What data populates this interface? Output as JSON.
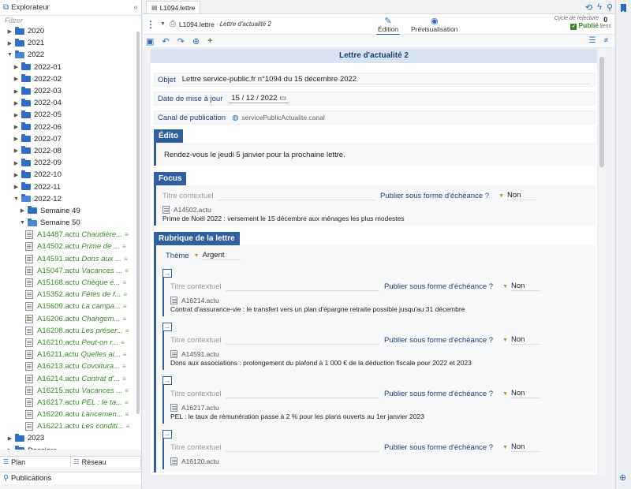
{
  "explorer": {
    "title": "Explorateur",
    "filter_placeholder": "Filtrer",
    "tree": [
      {
        "label": "2020",
        "kind": "folder",
        "level": 0,
        "expanded": false
      },
      {
        "label": "2021",
        "kind": "folder",
        "level": 0,
        "expanded": false
      },
      {
        "label": "2022",
        "kind": "folder",
        "level": 0,
        "expanded": true
      },
      {
        "label": "2022-01",
        "kind": "folder",
        "level": 1,
        "expanded": false
      },
      {
        "label": "2022-02",
        "kind": "folder",
        "level": 1,
        "expanded": false
      },
      {
        "label": "2022-03",
        "kind": "folder",
        "level": 1,
        "expanded": false
      },
      {
        "label": "2022-04",
        "kind": "folder",
        "level": 1,
        "expanded": false
      },
      {
        "label": "2022-05",
        "kind": "folder",
        "level": 1,
        "expanded": false
      },
      {
        "label": "2022-06",
        "kind": "folder",
        "level": 1,
        "expanded": false
      },
      {
        "label": "2022-07",
        "kind": "folder",
        "level": 1,
        "expanded": false
      },
      {
        "label": "2022-08",
        "kind": "folder",
        "level": 1,
        "expanded": false
      },
      {
        "label": "2022-09",
        "kind": "folder",
        "level": 1,
        "expanded": false
      },
      {
        "label": "2022-10",
        "kind": "folder",
        "level": 1,
        "expanded": false
      },
      {
        "label": "2022-11",
        "kind": "folder",
        "level": 1,
        "expanded": false
      },
      {
        "label": "2022-12",
        "kind": "folder",
        "level": 1,
        "expanded": true
      },
      {
        "label": "Semaine 49",
        "kind": "folder",
        "level": 2,
        "expanded": false
      },
      {
        "label": "Semaine 50",
        "kind": "folder",
        "level": 2,
        "expanded": true
      },
      {
        "id": "A14487.actu",
        "title": "Chaudière...",
        "kind": "doc",
        "level": 3
      },
      {
        "id": "A14502.actu",
        "title": "Prime de ...",
        "kind": "doc",
        "level": 3
      },
      {
        "id": "A14591.actu",
        "title": "Dons aux ...",
        "kind": "doc",
        "level": 3
      },
      {
        "id": "A15047.actu",
        "title": "Vacances ...",
        "kind": "doc",
        "level": 3
      },
      {
        "id": "A15168.actu",
        "title": "Chèque é...",
        "kind": "doc",
        "level": 3
      },
      {
        "id": "A15352.actu",
        "title": "Fêtes de f...",
        "kind": "doc",
        "level": 3
      },
      {
        "id": "A15609.actu",
        "title": "La campa...",
        "kind": "doc",
        "level": 3
      },
      {
        "id": "A16206.actu",
        "title": "Changem...",
        "kind": "doc",
        "level": 3,
        "warning": true
      },
      {
        "id": "A16208.actu",
        "title": "Les préser...",
        "kind": "doc",
        "level": 3
      },
      {
        "id": "A16210.actu",
        "title": "Peut-on r...",
        "kind": "doc",
        "level": 3
      },
      {
        "id": "A16211.actu",
        "title": "Quelles ai...",
        "kind": "doc",
        "level": 3
      },
      {
        "id": "A16213.actu",
        "title": "Covoitura...",
        "kind": "doc",
        "level": 3
      },
      {
        "id": "A16214.actu",
        "title": "Contrat d'...",
        "kind": "doc",
        "level": 3
      },
      {
        "id": "A16215.actu",
        "title": "Vacances ...",
        "kind": "doc",
        "level": 3
      },
      {
        "id": "A16217.actu",
        "title": "PEL : le ta...",
        "kind": "doc",
        "level": 3
      },
      {
        "id": "A16220.actu",
        "title": "Lancemen...",
        "kind": "doc",
        "level": 3
      },
      {
        "id": "A16221.actu",
        "title": "Les conditi...",
        "kind": "doc",
        "level": 3
      },
      {
        "label": "2023",
        "kind": "folder",
        "level": 0,
        "expanded": false
      },
      {
        "label": "Dossiers",
        "kind": "folder",
        "level": 0,
        "expanded": false
      }
    ],
    "tab_plan": "Plan",
    "tab_reseau": "Réseau",
    "publications": "Publications"
  },
  "main": {
    "tab_title": "L1094.lettre",
    "doc_name": "L1094.lettre",
    "doc_subtitle": "· Lettre d'actualité 2",
    "mode_edit": "Édition",
    "mode_preview": "Prévisualisation",
    "cycle_label": "Cycle de relecture",
    "cycle_value": "Publié",
    "links_count": "0",
    "links_label": "liens",
    "form": {
      "title": "Lettre d'actualité 2",
      "objet_label": "Objet",
      "objet_value": "Lettre service-public.fr n°1094 du 15 décembre 2022",
      "date_label": "Date de mise à jour",
      "date_value": "15 / 12 / 2022",
      "canal_label": "Canal de publication",
      "canal_value": "servicePublicActualite.canal",
      "edito_heading": "Édito",
      "edito_text": "Rendez-vous le jeudi 5 janvier pour la prochaine lettre.",
      "focus_heading": "Focus",
      "ph_title": "Titre contextuel",
      "publish_label": "Publier sous forme d'échéance ?",
      "publish_value": "Non",
      "focus_ref": "A14502.actu",
      "focus_desc": "Prime de Noël 2022 : versement le 15 décembre aux ménages les plus modestes",
      "rubrique_heading": "Rubrique de la lettre",
      "theme_label": "Thème",
      "theme_value": "Argent",
      "items": [
        {
          "ref": "A16214.actu",
          "desc": "Contrat d'assurance-vie : le transfert vers un plan d'épargne retraite possible jusqu'au 31 décembre"
        },
        {
          "ref": "A14591.actu",
          "desc": "Dons aux associations : prolongement du plafond à 1 000 € de la déduction fiscale pour 2022 et 2023"
        },
        {
          "ref": "A16217.actu",
          "desc": "PEL : le taux de rémunération passe à 2 % pour les plans ouverts au 1er janvier 2023"
        },
        {
          "ref": "A16120.actu",
          "desc": ""
        }
      ]
    }
  },
  "colors": {
    "accent": "#2a6db5",
    "section": "#2f5f9e",
    "published": "#3a8a2a"
  }
}
